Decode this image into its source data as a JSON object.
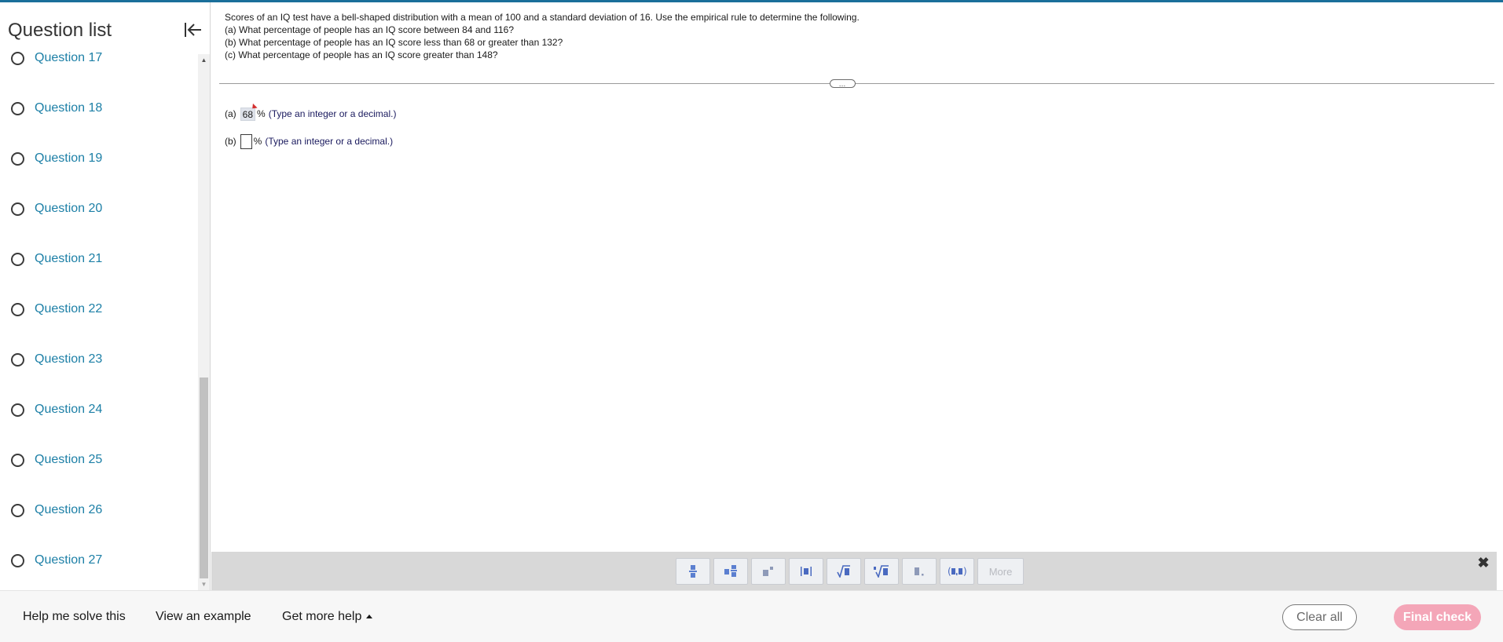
{
  "sidebar": {
    "title": "Question list",
    "questions": [
      {
        "label": "Question 17"
      },
      {
        "label": "Question 18"
      },
      {
        "label": "Question 19"
      },
      {
        "label": "Question 20"
      },
      {
        "label": "Question 21"
      },
      {
        "label": "Question 22"
      },
      {
        "label": "Question 23"
      },
      {
        "label": "Question 24"
      },
      {
        "label": "Question 25"
      },
      {
        "label": "Question 26"
      },
      {
        "label": "Question 27"
      }
    ]
  },
  "question": {
    "lines": [
      "Scores of an IQ test have a bell-shaped distribution with a mean of 100 and a standard deviation of 16. Use the empirical rule to determine the following.",
      "(a) What percentage of people has an IQ score between 84 and 116?",
      "(b) What percentage of people has an IQ score less than 68 or greater than 132?",
      "(c) What percentage of people has an IQ score greater than 148?"
    ],
    "handle_label": "…"
  },
  "answers": [
    {
      "part": "(a)",
      "value": "68",
      "unit": "%",
      "hint": "(Type an integer or a decimal.)"
    },
    {
      "part": "(b)",
      "value": "",
      "unit": "%",
      "hint": "(Type an integer or a decimal.)"
    }
  ],
  "mathbar": {
    "buttons": [
      {
        "icon": "fraction-icon",
        "glyph": "▃̲▃"
      },
      {
        "icon": "mixed-number-icon",
        "glyph": "▪▃"
      },
      {
        "icon": "exponent-icon",
        "glyph": "▪˙"
      },
      {
        "icon": "absolute-value-icon",
        "glyph": "|▪|"
      },
      {
        "icon": "square-root-icon",
        "glyph": "√▪"
      },
      {
        "icon": "nth-root-icon",
        "glyph": "∛▪"
      },
      {
        "icon": "decimal-icon",
        "glyph": "▪."
      },
      {
        "icon": "ordered-pair-icon",
        "glyph": "(▪,▪)"
      }
    ],
    "more_label": "More",
    "close_glyph": "✖"
  },
  "footer": {
    "help_label": "Help me solve this",
    "example_label": "View an example",
    "more_help_label": "Get more help",
    "clear_label": "Clear all",
    "final_label": "Final check"
  },
  "colors": {
    "accent": "#1a6f9a",
    "link": "#1c7fa6",
    "final_check": "#f4a6b8",
    "toolbar": "#d8d8d8"
  }
}
